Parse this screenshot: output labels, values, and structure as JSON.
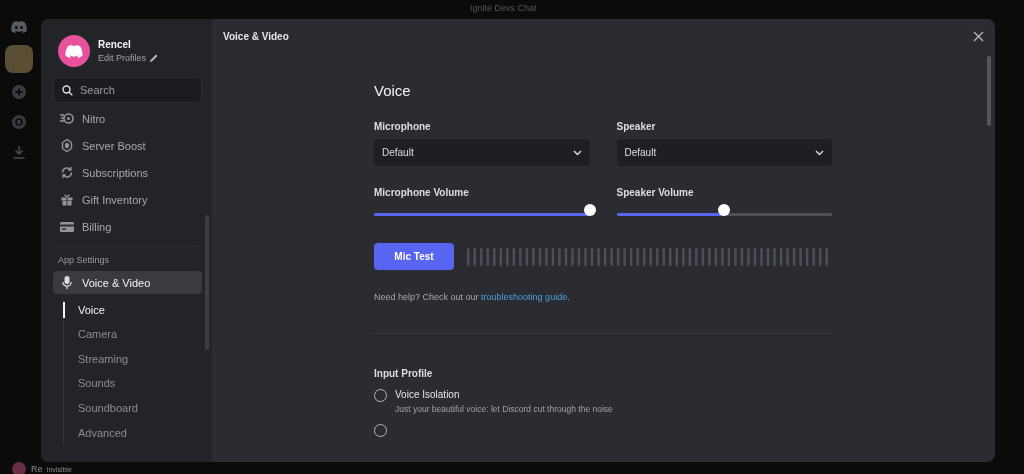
{
  "backdrop": {
    "channel_title": "Ignite Devs Chat",
    "user_name": "Re",
    "user_status": "Invisible"
  },
  "profile": {
    "name": "Rencel",
    "edit_label": "Edit Profiles"
  },
  "search": {
    "placeholder": "Search"
  },
  "sidebar": {
    "items": [
      {
        "label": "Nitro",
        "kind": "nitro",
        "selected": false
      },
      {
        "label": "Server Boost",
        "kind": "boost",
        "selected": false
      },
      {
        "label": "Subscriptions",
        "kind": "subscriptions",
        "selected": false
      },
      {
        "label": "Gift Inventory",
        "kind": "gift",
        "selected": false
      },
      {
        "label": "Billing",
        "kind": "billing",
        "selected": false
      }
    ],
    "section_label": "App Settings",
    "active": {
      "label": "Voice & Video",
      "selected": true
    },
    "subitems": [
      {
        "label": "Voice",
        "selected": true
      },
      {
        "label": "Camera",
        "selected": false
      },
      {
        "label": "Streaming",
        "selected": false
      },
      {
        "label": "Sounds",
        "selected": false
      },
      {
        "label": "Soundboard",
        "selected": false
      },
      {
        "label": "Advanced",
        "selected": false
      }
    ]
  },
  "header": {
    "title": "Voice & Video"
  },
  "voice": {
    "heading": "Voice",
    "devices": [
      {
        "label": "Microphone",
        "value": "Default"
      },
      {
        "label": "Speaker",
        "value": "Default"
      }
    ],
    "volumes": [
      {
        "label": "Microphone Volume",
        "level": 1.0
      },
      {
        "label": "Speaker Volume",
        "level": 0.5
      }
    ],
    "mic_test_button": "Mic Test",
    "help_text": "Need help? Check out our ",
    "help_link": "troubleshooting guide",
    "help_end": "."
  },
  "input_profile": {
    "heading": "Input Profile",
    "options": [
      {
        "label": "Voice Isolation",
        "description": "Just your beautiful voice: let Discord cut through the noise",
        "selected": false
      },
      {
        "selected": false
      }
    ]
  }
}
